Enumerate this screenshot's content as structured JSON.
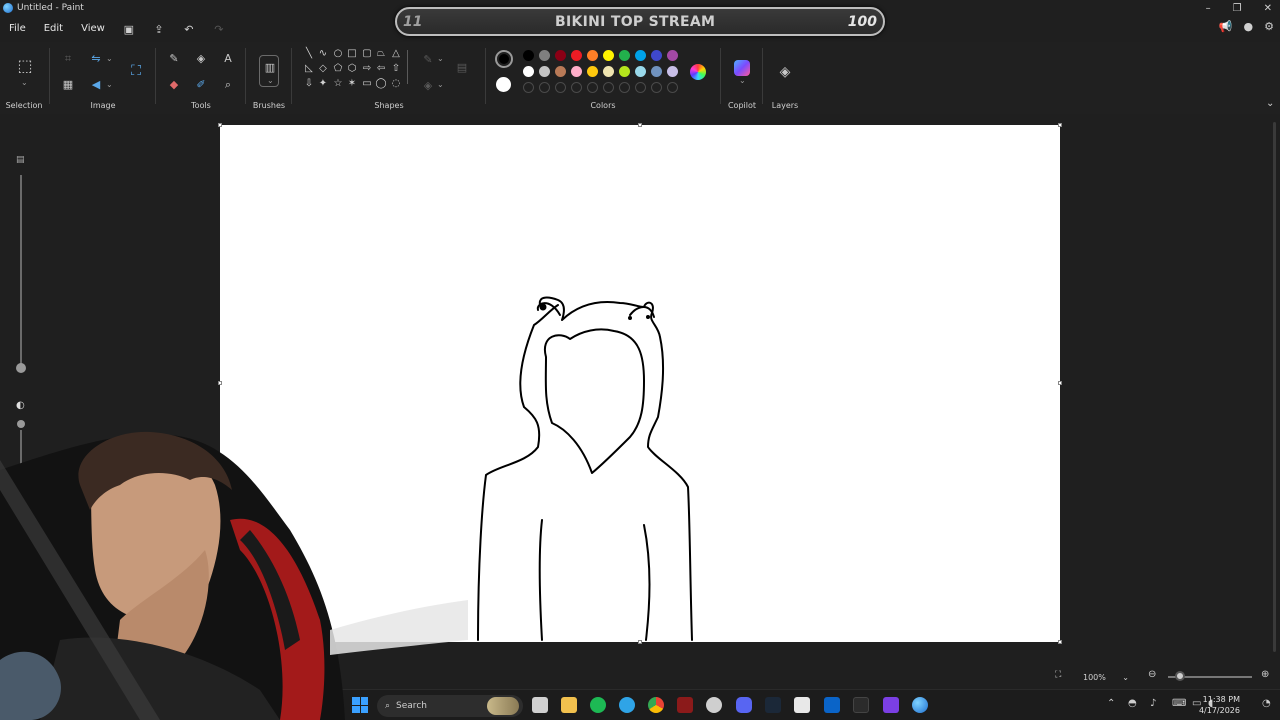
{
  "window": {
    "title": "Untitled - Paint",
    "controls": [
      "–",
      "❐",
      "✕"
    ]
  },
  "stream_overlay": {
    "left_number": "11",
    "label": "BIKINI TOP STREAM",
    "right_number": "100"
  },
  "menu": {
    "file": "File",
    "edit": "Edit",
    "view": "View"
  },
  "ribbon": {
    "groups": {
      "selection": "Selection",
      "image": "Image",
      "tools": "Tools",
      "brushes": "Brushes",
      "shapes": "Shapes",
      "colors": "Colors",
      "copilot": "Copilot",
      "layers": "Layers"
    },
    "colors": {
      "primary": "#000000",
      "secondary": "#ffffff",
      "row1": [
        "#000000",
        "#7f7f7f",
        "#8b0015",
        "#ed1c24",
        "#ff7f27",
        "#fff200",
        "#22b14c",
        "#00a2e8",
        "#3f48cc",
        "#a349a4"
      ],
      "row2": [
        "#ffffff",
        "#c3c3c3",
        "#b97a57",
        "#ffaec9",
        "#ffc90e",
        "#efe4b0",
        "#b5e61d",
        "#99d9ea",
        "#7092be",
        "#c8bfe7"
      ]
    }
  },
  "status": {
    "zoom_label": "100%",
    "zoom_level_percent": 100
  },
  "taskbar": {
    "search_placeholder": "Search",
    "time": "11:38 PM",
    "date": "4/17/2026"
  }
}
